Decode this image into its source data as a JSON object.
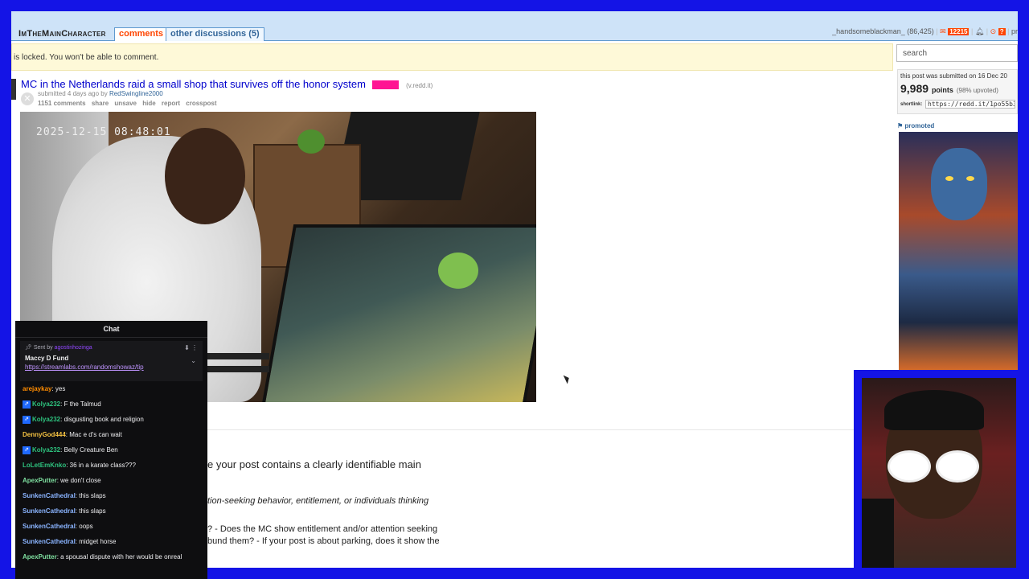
{
  "header": {
    "subreddit_logo": "ImTheMainCharacter",
    "tabs": [
      {
        "label": "comments",
        "active": true
      },
      {
        "label": "other discussions (5)",
        "active": false
      }
    ],
    "user": "_handsomeblackman_",
    "karma": "(86,425)",
    "mail_count": "12215",
    "extra": "pr"
  },
  "locked_notice": "is locked. You won't be able to comment.",
  "post": {
    "title": "MC in the Netherlands raid a small shop that survives off the honor system",
    "flair": "VIDEO",
    "domain": "(v.redd.it)",
    "submitted_prefix": "submitted 4 days ago by",
    "author": "RedSwingline2000",
    "actions": [
      "1151 comments",
      "share",
      "unsave",
      "hide",
      "report",
      "crosspost"
    ],
    "video_timestamp": "2025-12-15 08:48:01"
  },
  "rules": {
    "line1": "e your post contains a clearly identifiable main",
    "line2": "tion-seeking behavior, entitlement, or individuals thinking",
    "line3": "? - Does the MC show entitlement and/or attention seeking",
    "line4": "bund them? - If your post is about parking, does it show the",
    "line5": ""
  },
  "sidebar": {
    "search_placeholder": "search",
    "submitted_on": "this post was submitted on 16 Dec 20",
    "points": "9,989",
    "points_label": "points",
    "upvoted": "(98% upvoted)",
    "shortlink_label": "shortlink:",
    "shortlink": "https://redd.it/1po55b3",
    "promoted": "promoted"
  },
  "chat": {
    "title": "Chat",
    "pinned": {
      "sent_by": "Sent by",
      "sender": "agostinhozinga",
      "title": "Maccy D Fund",
      "link": "https://streamlabs.com/randomshowaz/tip"
    },
    "messages": [
      {
        "user": "arejaykay",
        "text": ": yes",
        "color": "#ff8c00",
        "badge": false
      },
      {
        "user": "Kolya232",
        "text": ": F the Talmud",
        "color": "#2ec27e",
        "badge": true
      },
      {
        "user": "Kolya232",
        "text": ": disgusting book and religion",
        "color": "#2ec27e",
        "badge": true
      },
      {
        "user": "DennyGod444",
        "text": ": Mac e d's can wait",
        "color": "#f5c242",
        "badge": false
      },
      {
        "user": "Kolya232",
        "text": ": Belly Creature Ben",
        "color": "#2ec27e",
        "badge": true
      },
      {
        "user": "LoLetEmKnko",
        "text": ": 36 in a karate class???",
        "color": "#2ec27e",
        "badge": false
      },
      {
        "user": "ApexPutter",
        "text": ": we don't close",
        "color": "#7fe0a0",
        "badge": false
      },
      {
        "user": "SunkenCathedral",
        "text": ": this slaps",
        "color": "#8ab4ff",
        "badge": false
      },
      {
        "user": "SunkenCathedral",
        "text": ": this slaps",
        "color": "#8ab4ff",
        "badge": false
      },
      {
        "user": "SunkenCathedral",
        "text": ": oops",
        "color": "#8ab4ff",
        "badge": false
      },
      {
        "user": "SunkenCathedral",
        "text": ": midget horse",
        "color": "#8ab4ff",
        "badge": false
      },
      {
        "user": "ApexPutter",
        "text": ": a spousal dispute with her would be onreal",
        "color": "#7fe0a0",
        "badge": false
      }
    ]
  },
  "colors": {
    "frame": "#1414e6",
    "header_bg": "#cee3f8",
    "link": "#0000cc",
    "accent": "#ff4500"
  }
}
